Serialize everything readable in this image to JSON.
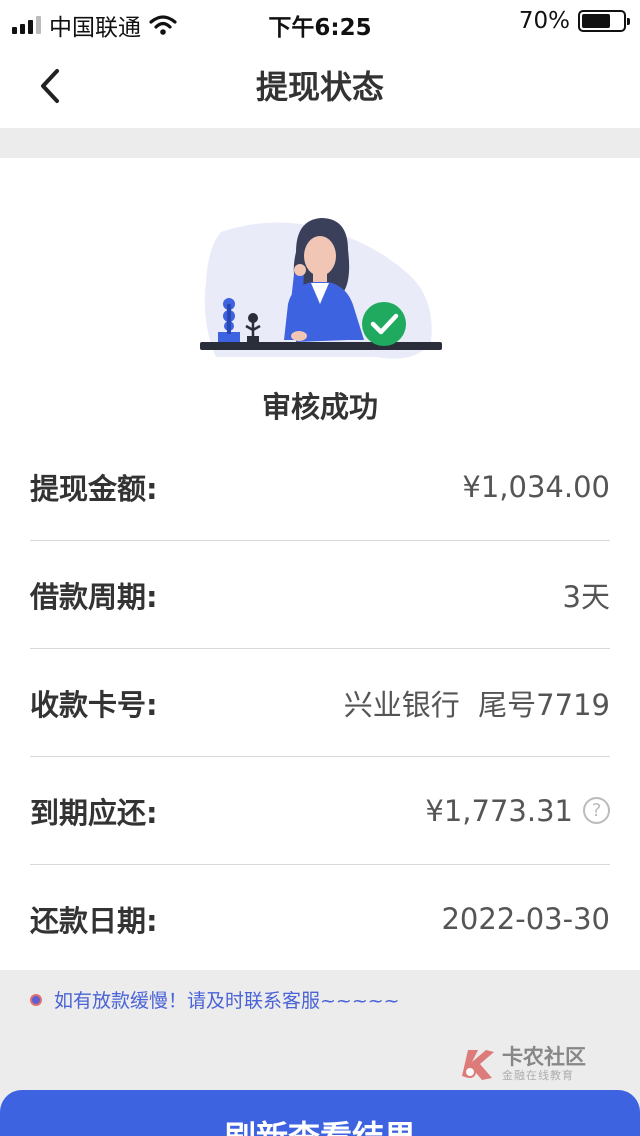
{
  "status_bar": {
    "carrier": "中国联通",
    "time": "下午6:25",
    "battery_percent": "70%",
    "battery_level": 0.7
  },
  "nav": {
    "title": "提现状态",
    "back_icon": "chevron-left-icon"
  },
  "result": {
    "status_text": "审核成功",
    "illustration_icon": "woman-at-desk-illustration",
    "check_icon": "check-circle-icon",
    "accent_color": "#3e63e0",
    "success_color": "#1faa60"
  },
  "details": [
    {
      "label": "提现金额:",
      "value": "¥1,034.00"
    },
    {
      "label": "借款周期:",
      "value": "3天"
    },
    {
      "label": "收款卡号:",
      "value": "兴业银行  尾号7719"
    },
    {
      "label": "到期应还:",
      "value": "¥1,773.31",
      "help_icon": "question-circle-icon",
      "help_symbol": "?"
    },
    {
      "label": "还款日期:",
      "value": "2022-03-30"
    }
  ],
  "notice": {
    "text": "如有放款缓慢！请及时联系客服~~~~~",
    "color": "#4a63d6"
  },
  "watermark": {
    "title": "卡农社区",
    "subtitle": "金融在线教育"
  },
  "footer": {
    "button_label": "刷新查看结果"
  }
}
